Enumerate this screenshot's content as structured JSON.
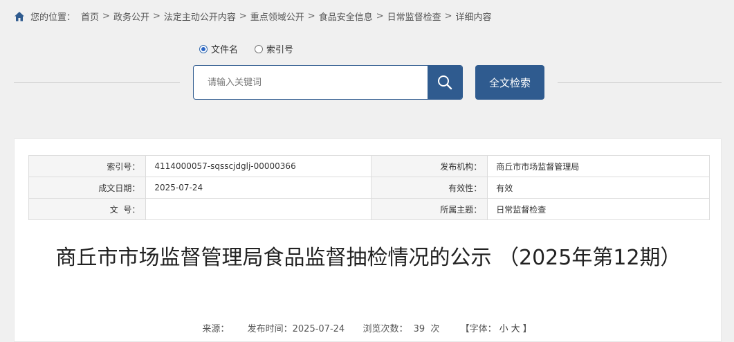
{
  "breadcrumb": {
    "prefix": "您的位置：",
    "items": [
      "首页",
      "政务公开",
      "法定主动公开内容",
      "重点领域公开",
      "食品安全信息",
      "日常监督检查",
      "详细内容"
    ],
    "separator": ">"
  },
  "search": {
    "radio_options": [
      {
        "label": "文件名",
        "checked": true
      },
      {
        "label": "索引号",
        "checked": false
      }
    ],
    "placeholder": "请输入关键词",
    "value": "",
    "fulltext_button": "全文检索"
  },
  "meta": {
    "index_label": "索引号：",
    "index_value": "4114000057-sqsscjdglj-00000366",
    "publisher_label": "发布机构：",
    "publisher_value": "商丘市市场监督管理局",
    "date_label": "成文日期：",
    "date_value": "2025-07-24",
    "validity_label": "有效性：",
    "validity_value": "有效",
    "docno_label": "文  号：",
    "docno_value": "",
    "topic_label": "所属主题：",
    "topic_value": "日常监督检查"
  },
  "article": {
    "title": "商丘市市场监督管理局食品监督抽检情况的公示 （2025年第12期）",
    "source_label": "来源：",
    "publish_label": "发布时间：2025-07-24",
    "views_label": "浏览次数：",
    "views_count": "39",
    "views_unit": "次",
    "font_label": "【字体：",
    "font_small": "小",
    "font_large": "大",
    "font_close": "】"
  },
  "colors": {
    "accent": "#2f5b8f",
    "background": "#f0f0f0"
  }
}
